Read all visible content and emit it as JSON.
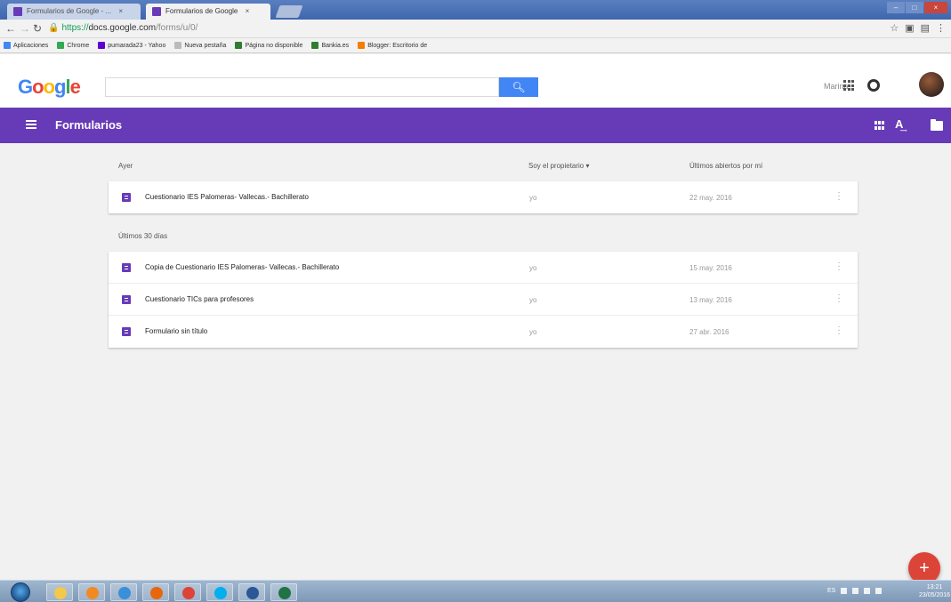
{
  "browser": {
    "tabs": [
      {
        "label": "Formularios de Google - ...",
        "active": false
      },
      {
        "label": "Formularios de Google",
        "active": true
      }
    ],
    "close_tab_glyph": "×",
    "url": {
      "secure_prefix": "https://",
      "host": "docs.google.com",
      "path": "/forms/u/0/"
    },
    "bookmarks": [
      {
        "label": "Aplicaciones",
        "color": "#4285f4"
      },
      {
        "label": "Chrome",
        "color": "#34a853"
      },
      {
        "label": "pumarada23 - Yahoo",
        "color": "#5f01d1"
      },
      {
        "label": "Nueva pestaña",
        "color": "#bbbbbb"
      },
      {
        "label": "Página no disponible",
        "color": "#2e7d32"
      },
      {
        "label": "Bankia.es",
        "color": "#2e7d32"
      },
      {
        "label": "Blogger: Escritorio de",
        "color": "#f57d00"
      }
    ]
  },
  "google_header": {
    "logo": "Google",
    "search_placeholder": "",
    "user_name": "Marina"
  },
  "app_bar": {
    "title": "Formularios",
    "color": "#673ab7"
  },
  "list": {
    "columns": {
      "owner": "Soy el propietario ▾",
      "opened": "Últimos abiertos por mí"
    },
    "sections": [
      {
        "label": "Ayer",
        "rows": [
          {
            "name": "Cuestionario IES Palomeras- Vallecas.- Bachillerato",
            "owner": "yo",
            "date": "22 may. 2016"
          }
        ]
      },
      {
        "label": "Últimos 30 días",
        "rows": [
          {
            "name": "Copia de Cuestionario IES Palomeras- Vallecas.- Bachillerato",
            "owner": "yo",
            "date": "15 may. 2016"
          },
          {
            "name": "Cuestionario TICs para profesores",
            "owner": "yo",
            "date": "13 may. 2016"
          },
          {
            "name": "Formulario sin título",
            "owner": "yo",
            "date": "27 abr. 2016"
          }
        ]
      }
    ]
  },
  "fab": {
    "label": "+",
    "color": "#db4437"
  },
  "taskbar": {
    "apps": [
      {
        "name": "explorer",
        "color": "#f2c94c"
      },
      {
        "name": "media-player",
        "color": "#f08a24"
      },
      {
        "name": "internet-explorer",
        "color": "#3a8fd9"
      },
      {
        "name": "firefox",
        "color": "#e8660c"
      },
      {
        "name": "chrome",
        "color": "#db4437"
      },
      {
        "name": "skype",
        "color": "#00aff0"
      },
      {
        "name": "word",
        "color": "#2b5797"
      },
      {
        "name": "excel",
        "color": "#217346"
      }
    ],
    "language": "ES",
    "time": "13:21",
    "date": "23/05/2016"
  }
}
